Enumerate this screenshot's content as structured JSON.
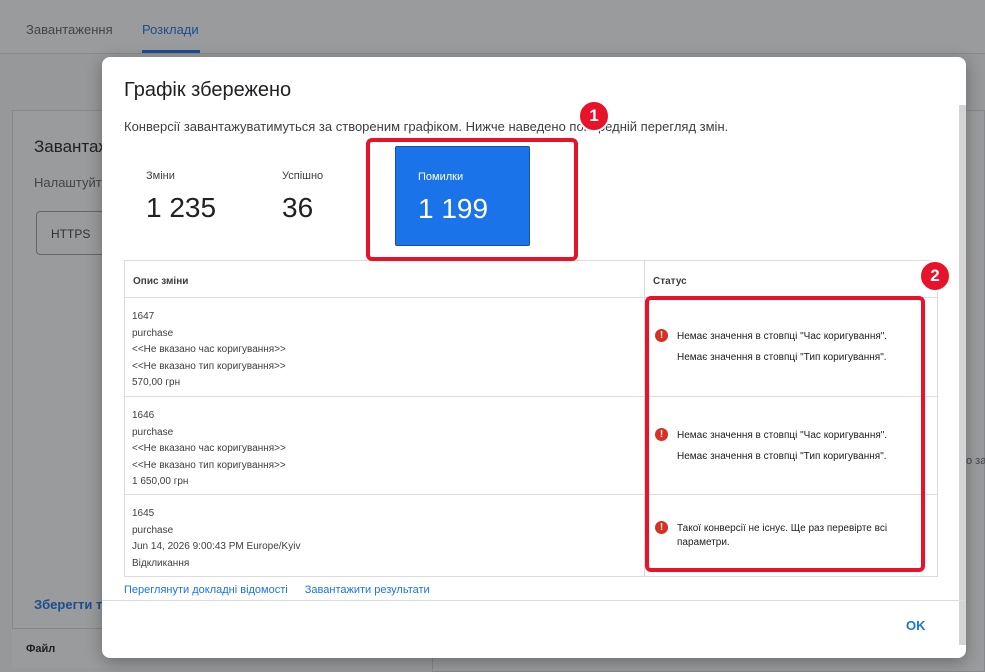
{
  "background": {
    "tabs": [
      {
        "label": "Завантаження"
      },
      {
        "label": "Розклади"
      }
    ],
    "card_title": "Завантаж",
    "card_subtitle": "Налаштуйт",
    "field_value": "HTTPS",
    "save_label": "Зберегти та",
    "file_column": "Файл",
    "right_text": "о за"
  },
  "dialog": {
    "title": "Графік збережено",
    "description": "Конверсії завантажуватимуться за створеним графіком. Нижче наведено попередній перегляд змін.",
    "stats": {
      "changes_label": "Зміни",
      "changes_value": "1 235",
      "success_label": "Успішно",
      "success_value": "36",
      "errors_label": "Помилки",
      "errors_value": "1 199"
    },
    "table": {
      "headers": [
        "Опис зміни",
        "Статус"
      ],
      "rows": [
        {
          "id": "1647",
          "action": "purchase",
          "line3": "<<Не вказано час коригування>>",
          "line4": "<<Не вказано тип коригування>>",
          "line5": "570,00 грн",
          "status1": "Немає значення в стовпці \"Час коригування\".",
          "status2": "Немає значення в стовпці \"Тип коригування\"."
        },
        {
          "id": "1646",
          "action": "purchase",
          "line3": "<<Не вказано час коригування>>",
          "line4": "<<Не вказано тип коригування>>",
          "line5": "1 650,00 грн",
          "status1": "Немає значення в стовпці \"Час коригування\".",
          "status2": "Немає значення в стовпці \"Тип коригування\"."
        },
        {
          "id": "1645",
          "action": "purchase",
          "line3": "Jun 14, 2026 9:00:43 PM Europe/Kyiv",
          "line4": "Відкликання",
          "status1": "Такої конверсії не існує. Ще раз перевірте всі параметри."
        }
      ]
    },
    "links": {
      "details": "Переглянути докладні відомості",
      "download": "Завантажити результати"
    },
    "ok_label": "OK"
  },
  "annotations": {
    "badge1": "1",
    "badge2": "2"
  },
  "colors": {
    "accent": "#1a73e8",
    "error": "#d93025",
    "annotation": "#e8132a"
  }
}
